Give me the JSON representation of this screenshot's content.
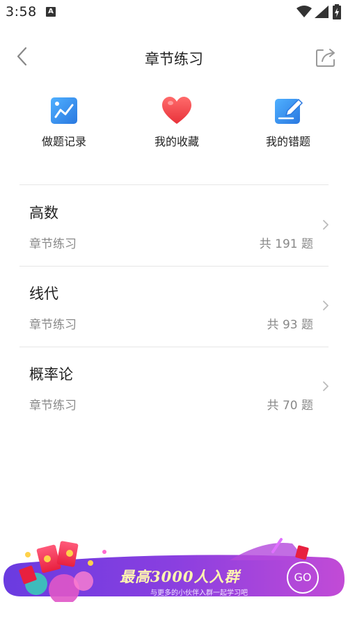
{
  "status_bar": {
    "time": "3:58",
    "notification_icon": "A"
  },
  "nav": {
    "title": "章节练习",
    "back_icon": "chevron-left-icon",
    "share_icon": "share-icon"
  },
  "quick_actions": [
    {
      "label": "做题记录",
      "icon": "record-chart-icon",
      "color": "#2f86e8"
    },
    {
      "label": "我的收藏",
      "icon": "heart-icon",
      "color": "#f04a4a"
    },
    {
      "label": "我的错题",
      "icon": "edit-icon",
      "color": "#2f86e8"
    }
  ],
  "courses": [
    {
      "title": "高数",
      "subtitle": "章节练习",
      "count_text": "共 191 题"
    },
    {
      "title": "线代",
      "subtitle": "章节练习",
      "count_text": "共 93 题"
    },
    {
      "title": "概率论",
      "subtitle": "章节练习",
      "count_text": "共 70 题"
    }
  ],
  "banner": {
    "headline": "最高3000人入群",
    "subline": "与更多的小伙伴入群一起学习吧",
    "go_label": "GO",
    "gradient_start": "#5b3fd6",
    "gradient_end": "#c04ad0"
  }
}
